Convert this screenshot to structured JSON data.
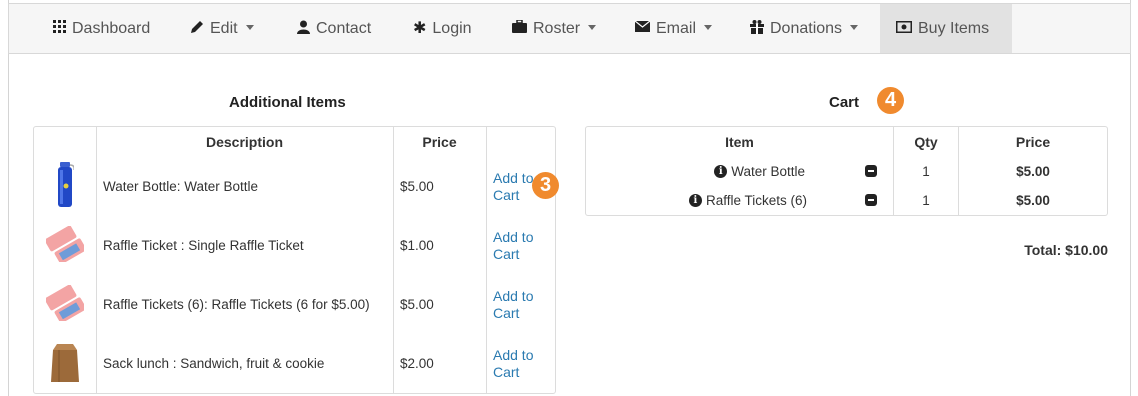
{
  "nav": {
    "items": [
      {
        "label": "Dashboard",
        "icon": "grid-icon",
        "dropdown": false
      },
      {
        "label": "Edit",
        "icon": "pencil-icon",
        "dropdown": true
      },
      {
        "label": "Contact",
        "icon": "user-icon",
        "dropdown": false
      },
      {
        "label": "Login",
        "icon": "asterisk-icon",
        "dropdown": false
      },
      {
        "label": "Roster",
        "icon": "briefcase-icon",
        "dropdown": true
      },
      {
        "label": "Email",
        "icon": "envelope-icon",
        "dropdown": true
      },
      {
        "label": "Donations",
        "icon": "gift-icon",
        "dropdown": true
      },
      {
        "label": "Buy Items",
        "icon": "money-icon",
        "dropdown": false,
        "active": true
      }
    ]
  },
  "additional": {
    "title": "Additional Items",
    "headers": {
      "description": "Description",
      "price": "Price"
    },
    "rows": [
      {
        "image": "water-bottle-image",
        "description": "Water Bottle: Water Bottle",
        "price": "$5.00",
        "action": "Add to Cart"
      },
      {
        "image": "raffle-ticket-image",
        "description": "Raffle Ticket : Single Raffle Ticket",
        "price": "$1.00",
        "action": "Add to Cart"
      },
      {
        "image": "raffle-tickets-image",
        "description": "Raffle Tickets (6): Raffle Tickets (6 for $5.00)",
        "price": "$5.00",
        "action": "Add to Cart"
      },
      {
        "image": "sack-lunch-image",
        "description": "Sack lunch : Sandwich, fruit & cookie",
        "price": "$2.00",
        "action": "Add to Cart"
      }
    ]
  },
  "cart": {
    "title": "Cart",
    "headers": {
      "item": "Item",
      "qty": "Qty",
      "price": "Price"
    },
    "rows": [
      {
        "item": "Water Bottle",
        "qty": "1",
        "price": "$5.00"
      },
      {
        "item": "Raffle Tickets (6)",
        "qty": "1",
        "price": "$5.00"
      }
    ],
    "total": "Total: $10.00"
  },
  "badges": {
    "step3": "3",
    "step4": "4"
  },
  "colors": {
    "accent": "#f08a2e",
    "link": "#2a7ab0"
  }
}
